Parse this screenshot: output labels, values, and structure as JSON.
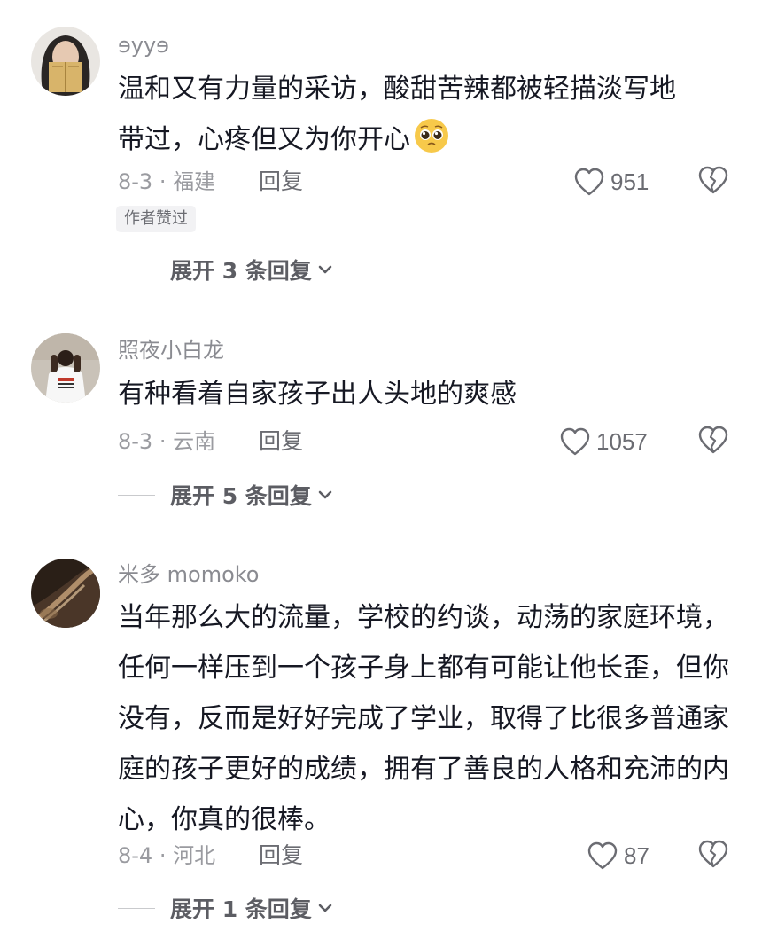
{
  "comments": [
    {
      "username": "ɘyyɘ",
      "text_line1": "温和又有力量的采访，酸甜苦辣都被轻描淡写地",
      "text_line2": "带过，心疼但又为你开心",
      "emoji": "pleading-face-emoji",
      "date_location": "8-3 · 福建",
      "reply_label": "回复",
      "likes": "951",
      "badge": "作者赞过",
      "expand_label": "展开 3 条回复"
    },
    {
      "username": "照夜小白龙",
      "text": "有种看着自家孩子出人头地的爽感",
      "date_location": "8-3 · 云南",
      "reply_label": "回复",
      "likes": "1057",
      "expand_label": "展开 5 条回复"
    },
    {
      "username": "米多 momoko",
      "text": "当年那么大的流量，学校的约谈，动荡的家庭环境，任何一样压到一个孩子身上都有可能让他长歪，但你没有，反而是好好完成了学业，取得了比很多普通家庭的孩子更好的成绩，拥有了善良的人格和充沛的内心，你真的很棒。",
      "date_location": "8-4 · 河北",
      "reply_label": "回复",
      "likes": "87",
      "expand_label": "展开 1 条回复"
    }
  ],
  "icons": {
    "like": "heart-outline-icon",
    "dislike": "broken-heart-icon",
    "expand": "chevron-down-icon"
  },
  "colors": {
    "text": "#161823",
    "secondary": "#8a8b91",
    "icon": "#6b6c72",
    "badge_bg": "#f2f2f4"
  }
}
